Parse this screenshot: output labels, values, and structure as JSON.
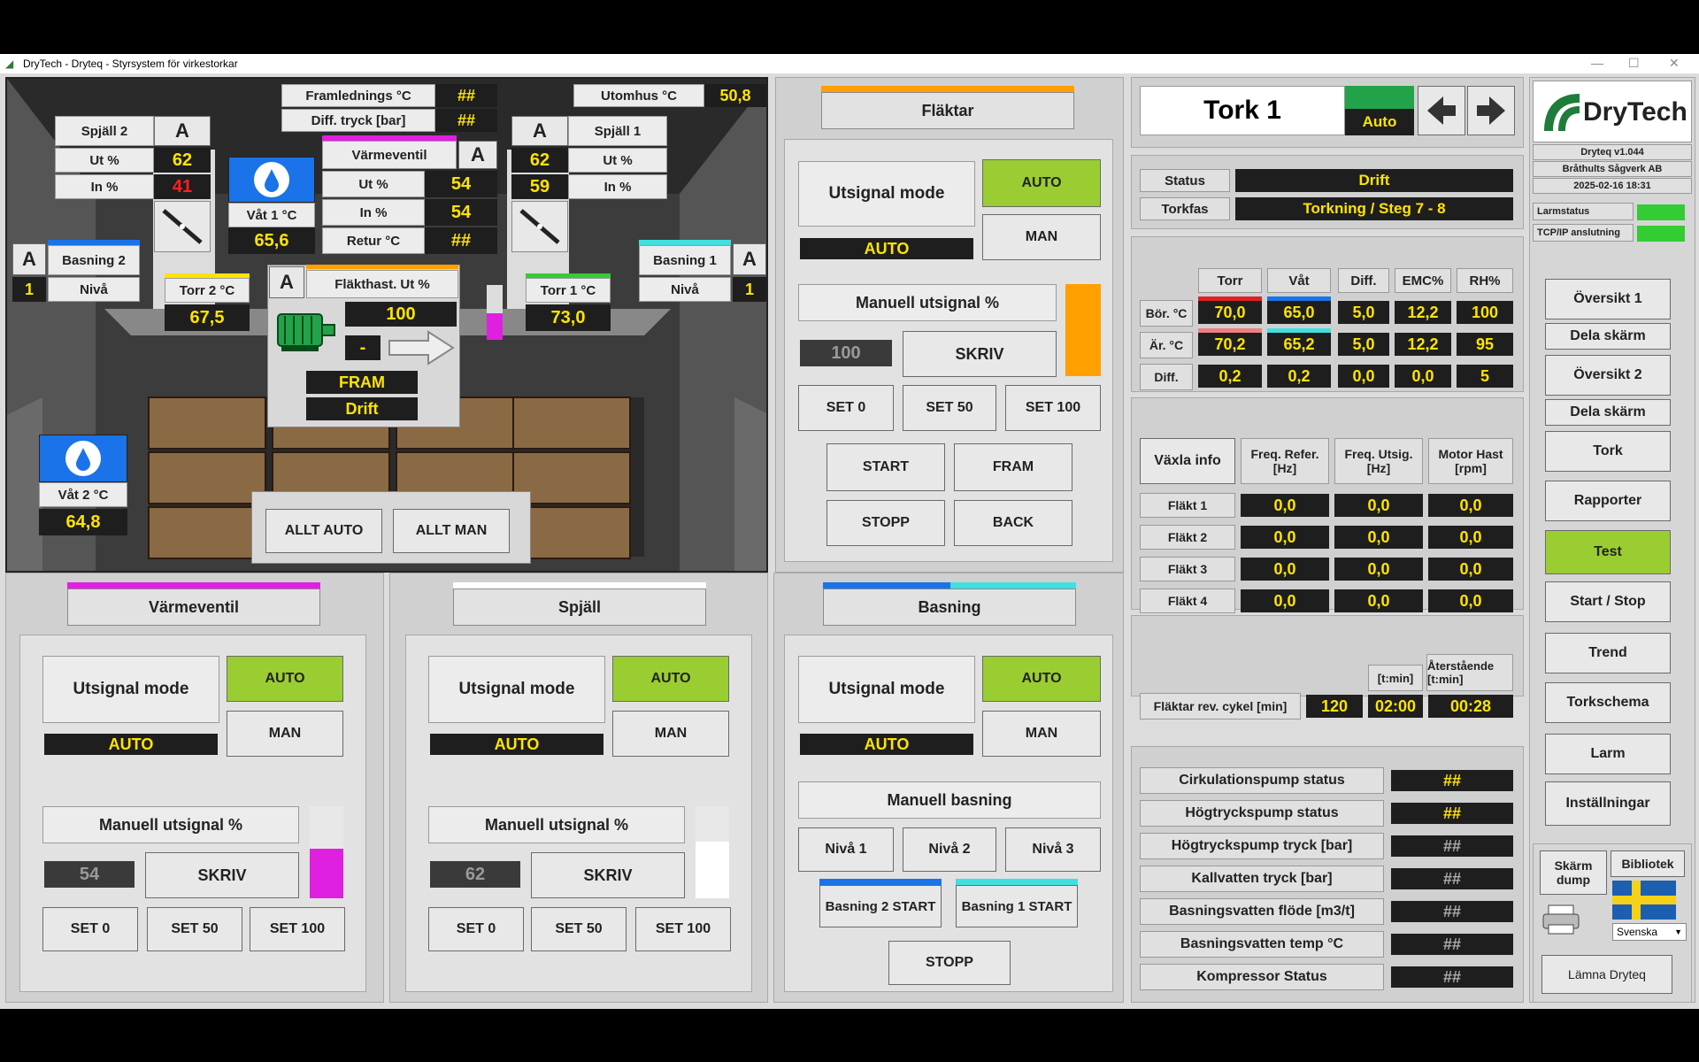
{
  "window": {
    "title": "DryTech - Dryteq - Styrsystem för virkestorkar"
  },
  "process": {
    "framledning_label": "Framlednings °C",
    "framledning_value": "##",
    "diff_tryck_label": "Diff. tryck [bar]",
    "diff_tryck_value": "##",
    "utomhus_label": "Utomhus °C",
    "utomhus_value": "50,8",
    "spjall2": {
      "title": "Spjäll 2",
      "mode": "A",
      "ut_label": "Ut %",
      "ut_value": "62",
      "in_label": "In %",
      "in_value": "41"
    },
    "spjall1": {
      "title": "Spjäll 1",
      "mode": "A",
      "ut_label": "Ut %",
      "ut_value": "62",
      "in_label": "In %",
      "in_value": "59"
    },
    "vat1": {
      "label": "Våt 1 °C",
      "value": "65,6"
    },
    "vat2": {
      "label": "Våt 2 °C",
      "value": "64,8"
    },
    "varmeventil": {
      "title": "Värmeventil",
      "mode": "A",
      "ut_label": "Ut %",
      "ut_value": "54",
      "in_label": "In %",
      "in_value": "54",
      "retur_label": "Retur °C",
      "retur_value": "##"
    },
    "basning2": {
      "mode": "A",
      "title": "Basning 2",
      "niva_value": "1",
      "niva_label": "Nivå"
    },
    "basning1": {
      "mode": "A",
      "title": "Basning 1",
      "niva_value": "1",
      "niva_label": "Nivå"
    },
    "torr2": {
      "label": "Torr 2 °C",
      "value": "67,5"
    },
    "torr1": {
      "label": "Torr 1 °C",
      "value": "73,0"
    },
    "flakthast": {
      "mode": "A",
      "label": "Fläkthast. Ut %",
      "value": "100",
      "dash": "-",
      "dir": "FRAM",
      "status": "Drift"
    },
    "allt_auto": "ALLT AUTO",
    "allt_man": "ALLT MAN"
  },
  "flaktar": {
    "title": "Fläktar",
    "mode_label": "Utsignal mode",
    "mode_value": "AUTO",
    "auto": "AUTO",
    "man": "MAN",
    "manual_label": "Manuell utsignal %",
    "manual_value": "100",
    "skriv": "SKRIV",
    "set0": "SET 0",
    "set50": "SET 50",
    "set100": "SET 100",
    "start": "START",
    "fram": "FRAM",
    "stopp": "STOPP",
    "back": "BACK"
  },
  "varmeventil_panel": {
    "title": "Värmeventil",
    "mode_label": "Utsignal mode",
    "mode_value": "AUTO",
    "auto": "AUTO",
    "man": "MAN",
    "manual_label": "Manuell utsignal %",
    "manual_value": "54",
    "skriv": "SKRIV",
    "set0": "SET 0",
    "set50": "SET 50",
    "set100": "SET 100",
    "level": 0.54
  },
  "spjall_panel": {
    "title": "Spjäll",
    "mode_label": "Utsignal mode",
    "mode_value": "AUTO",
    "auto": "AUTO",
    "man": "MAN",
    "manual_label": "Manuell utsignal %",
    "manual_value": "62",
    "skriv": "SKRIV",
    "set0": "SET 0",
    "set50": "SET 50",
    "set100": "SET 100",
    "level": 0.62
  },
  "basning_panel": {
    "title": "Basning",
    "mode_label": "Utsignal mode",
    "mode_value": "AUTO",
    "auto": "AUTO",
    "man": "MAN",
    "manual_label": "Manuell basning",
    "niva1": "Nivå 1",
    "niva2": "Nivå 2",
    "niva3": "Nivå 3",
    "b2start": "Basning 2 START",
    "b1start": "Basning 1 START",
    "stopp": "STOPP"
  },
  "tork": {
    "name": "Tork 1",
    "mode": "Auto"
  },
  "status": {
    "status_label": "Status",
    "status_value": "Drift",
    "torkfas_label": "Torkfas",
    "torkfas_value": "Torkning / Steg 7 - 8"
  },
  "climate": {
    "headers": [
      "Torr",
      "Våt",
      "Diff.",
      "EMC%",
      "RH%"
    ],
    "rows": [
      {
        "label": "Bör. °C",
        "values": [
          "70,0",
          "65,0",
          "5,0",
          "12,2",
          "100"
        ]
      },
      {
        "label": "Är. °C",
        "values": [
          "70,2",
          "65,2",
          "5,0",
          "12,2",
          "95"
        ]
      },
      {
        "label": "Diff.",
        "values": [
          "0,2",
          "0,2",
          "0,0",
          "0,0",
          "5"
        ]
      }
    ]
  },
  "vaxla": {
    "info_label": "Växla info",
    "headers": [
      "Freq. Refer. [Hz]",
      "Freq. Utsig. [Hz]",
      "Motor Hast [rpm]"
    ],
    "rows": [
      {
        "label": "Fläkt 1",
        "values": [
          "0,0",
          "0,0",
          "0,0"
        ]
      },
      {
        "label": "Fläkt 2",
        "values": [
          "0,0",
          "0,0",
          "0,0"
        ]
      },
      {
        "label": "Fläkt 3",
        "values": [
          "0,0",
          "0,0",
          "0,0"
        ]
      },
      {
        "label": "Fläkt 4",
        "values": [
          "0,0",
          "0,0",
          "0,0"
        ]
      }
    ]
  },
  "rev": {
    "tmin_label": "[t:min]",
    "remaining_label": "Återstående [t:min]",
    "label": "Fläktar rev. cykel [min]",
    "v1": "120",
    "v2": "02:00",
    "v3": "00:28"
  },
  "pumps": [
    {
      "label": "Cirkulationspump status",
      "value": "##",
      "dim": false
    },
    {
      "label": "Högtryckspump status",
      "value": "##",
      "dim": false
    },
    {
      "label": "Högtryckspump tryck [bar]",
      "value": "##",
      "dim": true
    },
    {
      "label": "Kallvatten tryck [bar]",
      "value": "##",
      "dim": true
    },
    {
      "label": "Basningsvatten flöde [m3/t]",
      "value": "##",
      "dim": true
    },
    {
      "label": "Basningsvatten temp °C",
      "value": "##",
      "dim": true
    },
    {
      "label": "Kompressor Status",
      "value": "##",
      "dim": true
    }
  ],
  "sidebar": {
    "brand": "DryTech",
    "version": "Dryteq v1.044",
    "company": "Bråthults Sågverk AB",
    "datetime": "2025-02-16 18:31",
    "larmstatus": "Larmstatus",
    "tcpip": "TCP/IP anslutning",
    "nav": [
      "Översikt 1",
      "Dela skärm",
      "Översikt 2",
      "Dela skärm",
      "Tork",
      "Rapporter",
      "Test",
      "Start / Stop",
      "Trend",
      "Torkschema",
      "Larm",
      "Inställningar"
    ],
    "skarm_dump": "Skärm dump",
    "bibliotek": "Bibliotek",
    "language": "Svenska",
    "lamna": "Lämna Dryteq"
  },
  "colors": {
    "accent_green": "#9acd32",
    "value_bg": "#1e1e1e",
    "value_fg": "#ffe400",
    "magenta": "#e020e0",
    "orange": "#ffa000",
    "status_green": "#33cc33"
  }
}
